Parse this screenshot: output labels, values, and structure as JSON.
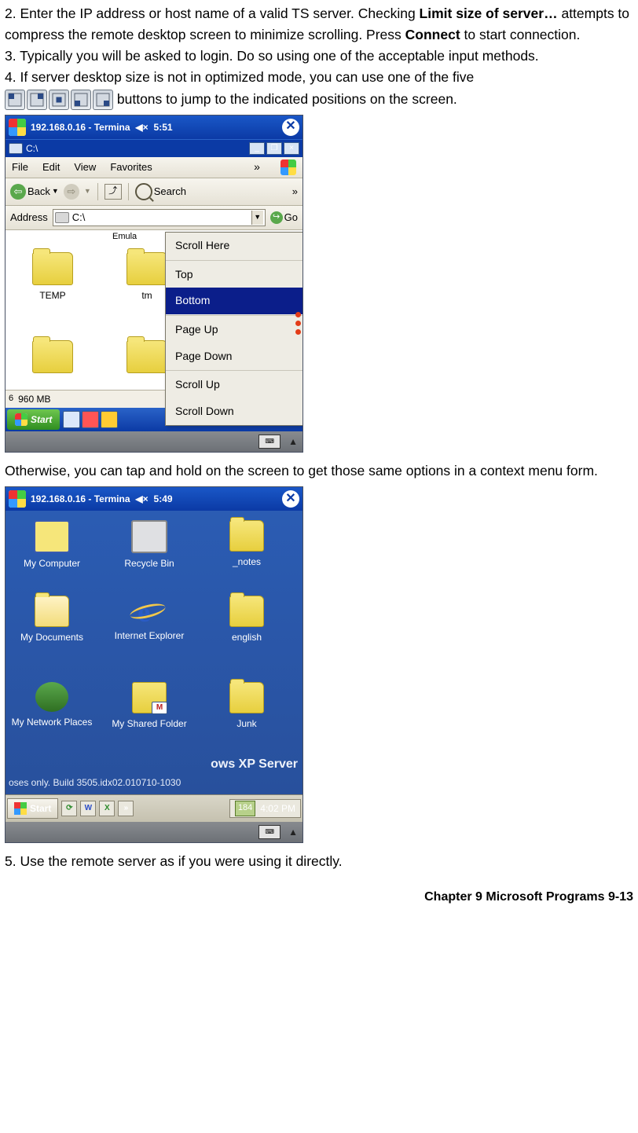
{
  "steps": {
    "two_a": "2.    Enter the IP address or host name of a valid TS server.    Checking ",
    "two_bold1": "Limit size of server…",
    "two_b": " attempts to compress the remote desktop screen to minimize scrolling.    Press ",
    "two_bold2": "Connect",
    "two_c": " to start connection.",
    "three": "3.    Typically you will be asked to login.    Do so using one of the acceptable input methods.",
    "four_a": "4.    If server desktop size is not in optimized mode, you can use one of the five",
    "four_b": " buttons to jump to the indicated positions on the screen.",
    "afterShot1": "Otherwise, you can tap and hold on the screen to get those same options in a context menu form.",
    "five": "5.    Use the remote server as if you were using it directly."
  },
  "shot1": {
    "title": "192.168.0.16 - Termina",
    "time": "5:51",
    "cdrive": "C:\\",
    "menu": {
      "file": "File",
      "edit": "Edit",
      "view": "View",
      "fav": "Favorites"
    },
    "toolbar": {
      "back": "Back",
      "search": "Search"
    },
    "addr": {
      "label": "Address",
      "value": "C:\\",
      "go": "Go"
    },
    "emula": "Emula",
    "folders": {
      "temp": "TEMP",
      "tmp": "tm"
    },
    "ctx": {
      "scroll_here": "Scroll Here",
      "top": "Top",
      "bottom": "Bottom",
      "page_up": "Page Up",
      "page_down": "Page Down",
      "scroll_up": "Scroll Up",
      "scroll_down": "Scroll Down"
    },
    "status": {
      "size": "960 MB",
      "my": "M"
    },
    "start": "Start"
  },
  "shot2": {
    "title": "192.168.0.16 - Termina",
    "time": "5:49",
    "icons": {
      "my_computer": "My Computer",
      "recycle": "Recycle Bin",
      "notes": "_notes",
      "my_docs": "My Documents",
      "ie": "Internet Explorer",
      "english": "english",
      "net_places": "My Network Places",
      "shared": "My Shared Folder",
      "junk": "Junk"
    },
    "water": "ows XP Server",
    "water2": "oses only. Build 3505.idx02.010710-1030",
    "start": "Start",
    "tray_num": "184",
    "tray_time": "4:02 PM"
  },
  "footer": {
    "chapter": "Chapter 9 Microsoft Programs",
    "page": "9-13"
  }
}
